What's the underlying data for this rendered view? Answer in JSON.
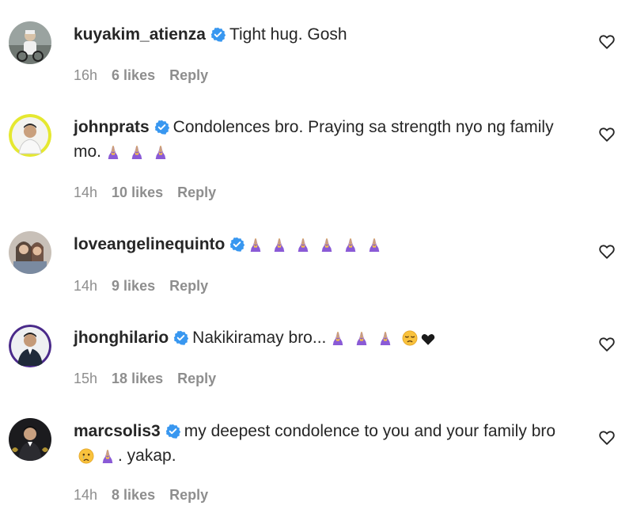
{
  "comments": [
    {
      "username": "kuyakim_atienza",
      "text": "Tight hug. Gosh",
      "emojis": [],
      "time": "16h",
      "likes": "6 likes",
      "reply": "Reply"
    },
    {
      "username": "johnprats",
      "text": "Condolences bro. Praying sa strength nyo ng family mo.",
      "emojis": [
        "folded-hands",
        "folded-hands",
        "folded-hands"
      ],
      "time": "14h",
      "likes": "10 likes",
      "reply": "Reply"
    },
    {
      "username": "loveangelinequinto",
      "text": "",
      "emojis": [
        "folded-hands",
        "folded-hands",
        "folded-hands",
        "folded-hands",
        "folded-hands",
        "folded-hands"
      ],
      "time": "14h",
      "likes": "9 likes",
      "reply": "Reply"
    },
    {
      "username": "jhonghilario",
      "text": "Nakikiramay bro...",
      "emojis": [
        "folded-hands",
        "folded-hands",
        "folded-hands",
        "pensive-face",
        "black-heart"
      ],
      "time": "15h",
      "likes": "18 likes",
      "reply": "Reply"
    },
    {
      "username": "marcsolis3",
      "text_part1": "my deepest condolence to you and your family",
      "text_part2": "bro",
      "text_part3": ". yakap.",
      "emojis": [
        "crying-face",
        "folded-hands"
      ],
      "time": "14h",
      "likes": "8 likes",
      "reply": "Reply"
    }
  ],
  "colors": {
    "text": "#262626",
    "meta": "#8e8e8e",
    "verified": "#3897f0",
    "emoji_purple": "#8a5ad6"
  }
}
